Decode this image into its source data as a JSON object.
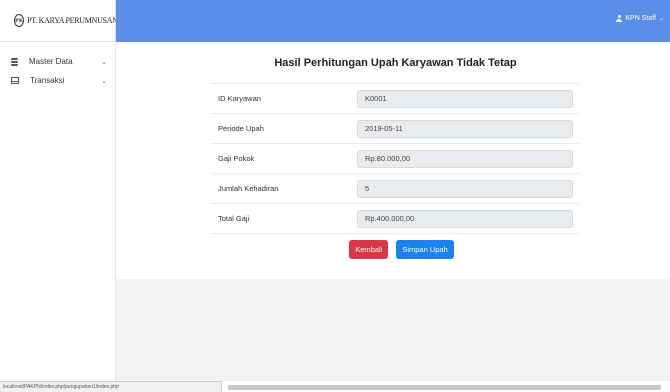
{
  "brand": {
    "logo_glyph": "PK",
    "name": "PT. KARYA PERUMNUSANTARA"
  },
  "sidebar": {
    "items": [
      {
        "label": "Master Data",
        "icon": "database-icon"
      },
      {
        "label": "Transaksi",
        "icon": "table-icon"
      }
    ]
  },
  "topbar": {
    "user_label": "KPN Staff"
  },
  "card": {
    "title": "Hasil Perhitungan Upah Karyawan Tidak Tetap",
    "rows": [
      {
        "label": "ID Karyawan",
        "value": "K0001"
      },
      {
        "label": "Periode Upah",
        "value": "2019-05-11"
      },
      {
        "label": "Gaji Pokok",
        "value": "Rp.80.000,00"
      },
      {
        "label": "Jumlah Kehadiran",
        "value": "5"
      },
      {
        "label": "Total Gaji",
        "value": "Rp.400.000,00"
      }
    ],
    "back_label": "Kembali",
    "save_label": "Simpan Upah"
  },
  "statusbar": {
    "url": "localhost/PAKPN/index.php/pengupahan1/index.php"
  },
  "colors": {
    "accent": "#5b8ee8",
    "danger": "#dc3545",
    "primary": "#1a82f0"
  }
}
